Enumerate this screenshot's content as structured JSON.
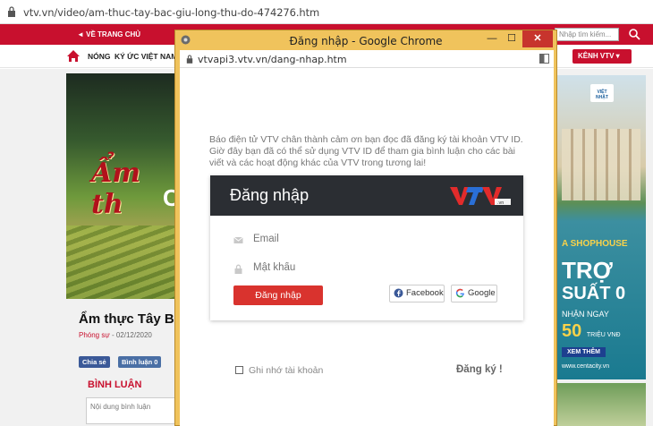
{
  "browser": {
    "url": "vtv.vn/video/am-thuc-tay-bac-giu-long-thu-do-474276.htm"
  },
  "site": {
    "topbar": {
      "home_link": "◄ VỀ TRANG CHỦ",
      "search_placeholder": "Nhập tìm kiếm..."
    },
    "nav": {
      "items": [
        "NÓNG",
        "KÝ ỨC VIỆT NAM"
      ],
      "kenh_label": "KÊNH VTV ▾"
    },
    "article": {
      "hero_script": "Ẩm th",
      "hero_big": "C",
      "title": "Ẩm thực Tây Bắc g",
      "category": "Phóng sự",
      "date": "- 02/12/2020",
      "share_label": "Chia sẻ",
      "comment_count_label": "Bình luận",
      "comment_count": "0",
      "comments_heading": "BÌNH LUẬN",
      "comment_placeholder": "Nội dung bình luận"
    },
    "ad": {
      "logo_text": "VIỆT NHẬT",
      "line1": "A SHOPHOUSE",
      "line2": "TRỢ",
      "line3": "SUẤT 0",
      "line4": "NHẬN NGAY",
      "amount": "50",
      "amount_unit": "TRIỆU VNĐ",
      "more": "XEM THÊM",
      "site": "www.centacity.vn"
    }
  },
  "popup": {
    "title": "Đăng nhập - Google Chrome",
    "url": "vtvapi3.vtv.vn/dang-nhap.htm",
    "window_buttons": {
      "minimize": "—",
      "maximize": "☐",
      "close": "✕"
    },
    "intro": "Báo điện tử VTV chân thành cảm ơn bạn đọc đã đăng ký tài khoản VTV ID. Giờ đây bạn đã có thể sử dụng VTV ID để tham gia bình luận cho các bài viết và các hoạt động khác của VTV trong tương lai!",
    "card_heading": "Đăng nhập",
    "logo_text": "VTV",
    "logo_suffix": ".vn",
    "email_placeholder": "Email",
    "password_placeholder": "Mật khẩu",
    "login_button": "Đăng nhập",
    "facebook_button": "Facebook",
    "google_button": "Google",
    "remember_label": "Ghi nhớ tài khoản",
    "register_link": "Đăng ký !"
  },
  "colors": {
    "brand_red": "#c8102e",
    "popup_frame": "#f0c35c",
    "login_red": "#d9332e",
    "card_header": "#2b2e33"
  }
}
